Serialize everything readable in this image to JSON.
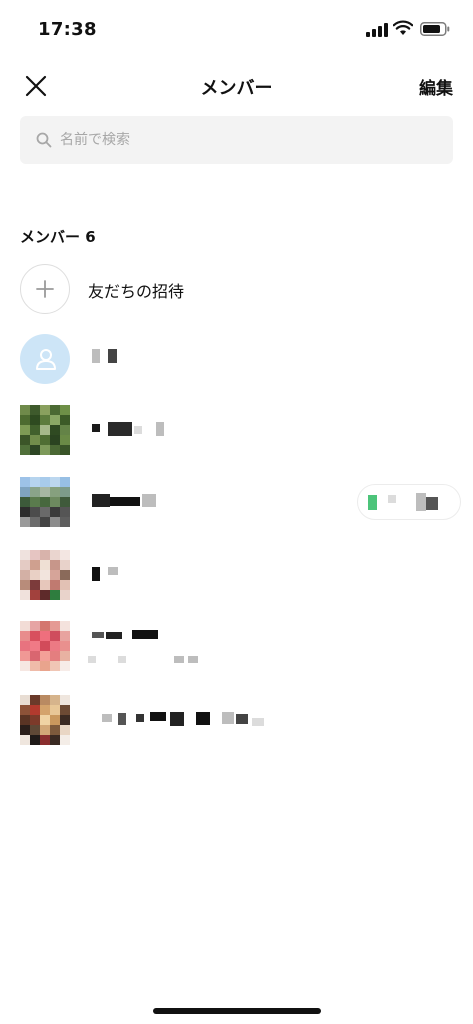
{
  "status_bar": {
    "time": "17:38"
  },
  "nav": {
    "title": "メンバー",
    "edit_label": "編集"
  },
  "search": {
    "placeholder": "名前で検索"
  },
  "section": {
    "title": "メンバー 6"
  },
  "invite": {
    "label": "友だちの招待"
  },
  "members": [
    {
      "name": "",
      "avatar": "default-avatar"
    },
    {
      "name": "",
      "avatar": "photo"
    },
    {
      "name": "",
      "avatar": "photo",
      "status_message": ""
    },
    {
      "name": "",
      "avatar": "photo"
    },
    {
      "name": "",
      "avatar": "photo",
      "sub_text": ""
    },
    {
      "name": "",
      "avatar": "photo"
    }
  ],
  "colors": {
    "accent_blue": "#cde5f7",
    "search_bg": "#f3f3f3",
    "status_green": "#4cc47a"
  }
}
